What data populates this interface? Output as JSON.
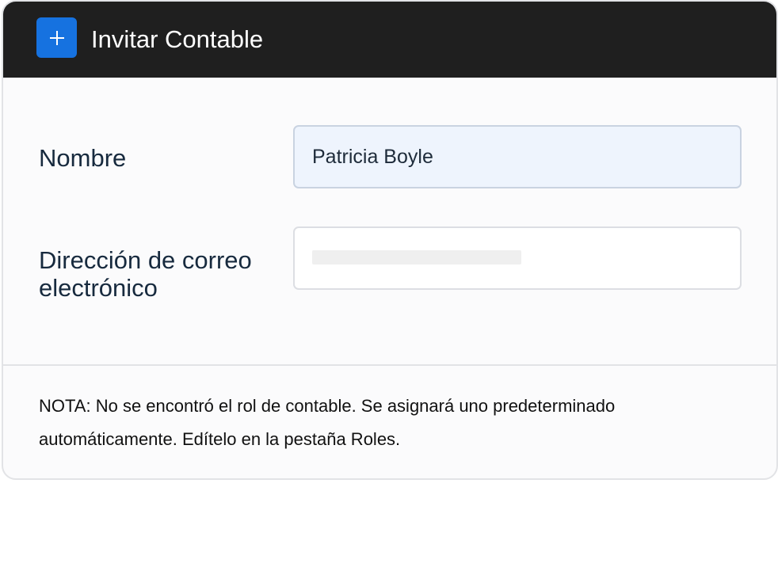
{
  "dialog": {
    "title": "Invitar Contable",
    "add_icon": "plus-icon"
  },
  "form": {
    "name_label": "Nombre",
    "name_value": "Patricia Boyle",
    "email_label": "Dirección de correo electrónico",
    "email_value": ""
  },
  "note": "NOTA: No se encontró el rol de contable. Se asignará uno predeterminado automáticamente. Edítelo en la pestaña Roles.",
  "colors": {
    "titlebar": "#1f1f1f",
    "accent": "#1672e0",
    "label_text": "#172a3e",
    "active_input_bg": "#eef4fd"
  }
}
